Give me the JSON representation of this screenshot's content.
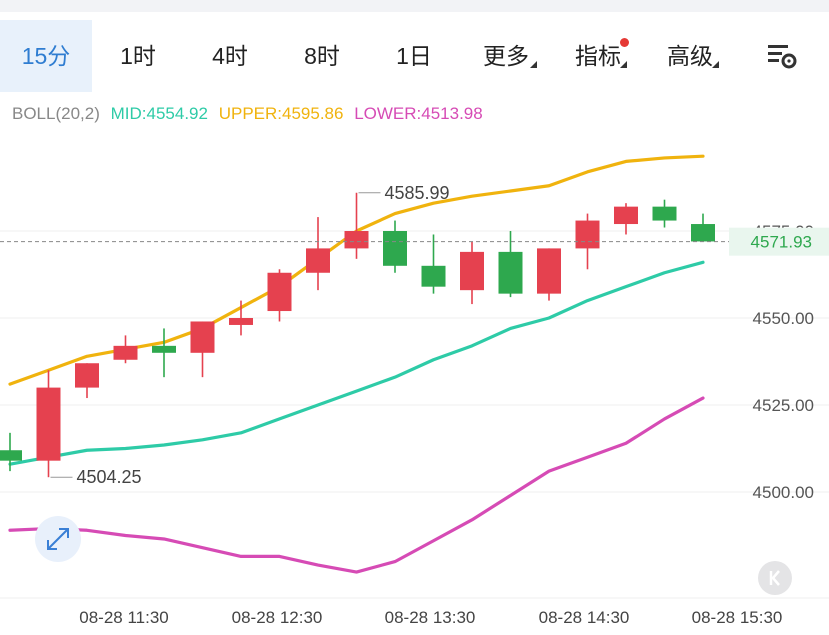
{
  "tabs": [
    {
      "label": "15分",
      "active": true
    },
    {
      "label": "1时"
    },
    {
      "label": "4时"
    },
    {
      "label": "8时"
    },
    {
      "label": "1日"
    },
    {
      "label": "更多",
      "corner": true
    },
    {
      "label": "指标",
      "corner": true,
      "dot": true
    },
    {
      "label": "高级",
      "corner": true
    }
  ],
  "indicator": {
    "name": "BOLL(20,2)",
    "mid": "MID:4554.92",
    "upper": "UPPER:4595.86",
    "lower": "LOWER:4513.98"
  },
  "colors": {
    "mid": "#2ecba7",
    "upper": "#f0b30e",
    "lower": "#d64bb5",
    "up": "#e5414f",
    "down": "#2ea84e",
    "accent": "#2f7dd1"
  },
  "icons": {
    "settings": "chart-settings-icon",
    "expand": "expand-arrows-icon",
    "back": "k-arrow-icon"
  },
  "chart_data": {
    "type": "candlestick",
    "ylim": [
      4475,
      4602
    ],
    "y_ticks": [
      {
        "value": 4500.0,
        "label": "4500.00"
      },
      {
        "value": 4525.0,
        "label": "4525.00"
      },
      {
        "value": 4550.0,
        "label": "4550.00"
      },
      {
        "value": 4575.0,
        "label": "4575.00"
      }
    ],
    "x_ticks": [
      "08-28 11:30",
      "08-28 12:30",
      "08-28 13:30",
      "08-28 14:30",
      "08-28 15:30"
    ],
    "candles": [
      {
        "open": 4512,
        "high": 4517,
        "low": 4506,
        "close": 4509
      },
      {
        "open": 4509,
        "high": 4535,
        "low": 4504.25,
        "close": 4530
      },
      {
        "open": 4530,
        "high": 4537,
        "low": 4527,
        "close": 4537
      },
      {
        "open": 4538,
        "high": 4545,
        "low": 4537,
        "close": 4542
      },
      {
        "open": 4542,
        "high": 4547,
        "low": 4533,
        "close": 4540
      },
      {
        "open": 4540,
        "high": 4549,
        "low": 4533,
        "close": 4549
      },
      {
        "open": 4548,
        "high": 4555,
        "low": 4545,
        "close": 4550
      },
      {
        "open": 4552,
        "high": 4564,
        "low": 4549,
        "close": 4563
      },
      {
        "open": 4563,
        "high": 4579,
        "low": 4558,
        "close": 4570
      },
      {
        "open": 4570,
        "high": 4585.99,
        "low": 4567,
        "close": 4575
      },
      {
        "open": 4575,
        "high": 4578,
        "low": 4563,
        "close": 4565
      },
      {
        "open": 4565,
        "high": 4574,
        "low": 4557,
        "close": 4559
      },
      {
        "open": 4558,
        "high": 4572,
        "low": 4554,
        "close": 4569
      },
      {
        "open": 4569,
        "high": 4575,
        "low": 4556,
        "close": 4557
      },
      {
        "open": 4557,
        "high": 4570,
        "low": 4555,
        "close": 4570
      },
      {
        "open": 4570,
        "high": 4580,
        "low": 4564,
        "close": 4578
      },
      {
        "open": 4577,
        "high": 4583,
        "low": 4574,
        "close": 4582
      },
      {
        "open": 4582,
        "high": 4584,
        "low": 4576,
        "close": 4578
      },
      {
        "open": 4577,
        "high": 4580,
        "low": 4572,
        "close": 4572
      }
    ],
    "mid": [
      4508,
      4510,
      4512,
      4512.5,
      4513.5,
      4515,
      4517,
      4521,
      4525,
      4529,
      4533,
      4538,
      4542,
      4547,
      4550,
      4555,
      4559,
      4563,
      4566
    ],
    "upper": [
      4531,
      4535,
      4539,
      4541,
      4543,
      4547,
      4553,
      4559,
      4567,
      4575,
      4580,
      4583,
      4585,
      4586.5,
      4588,
      4592,
      4595,
      4596,
      4596.5
    ],
    "lower": [
      4489,
      4489.5,
      4489,
      4487.5,
      4486.5,
      4484,
      4481.5,
      4481.5,
      4479,
      4477,
      4480,
      4486,
      4492,
      4499,
      4506,
      4510,
      4514,
      4521,
      4527
    ],
    "annotations": [
      {
        "label": "4585.99",
        "candle": 9,
        "value": 4585.99,
        "side": "right"
      },
      {
        "label": "4504.25",
        "candle": 1,
        "value": 4504.25,
        "side": "right"
      }
    ],
    "last_price": {
      "value": 4571.93,
      "label": "4571.93"
    }
  }
}
